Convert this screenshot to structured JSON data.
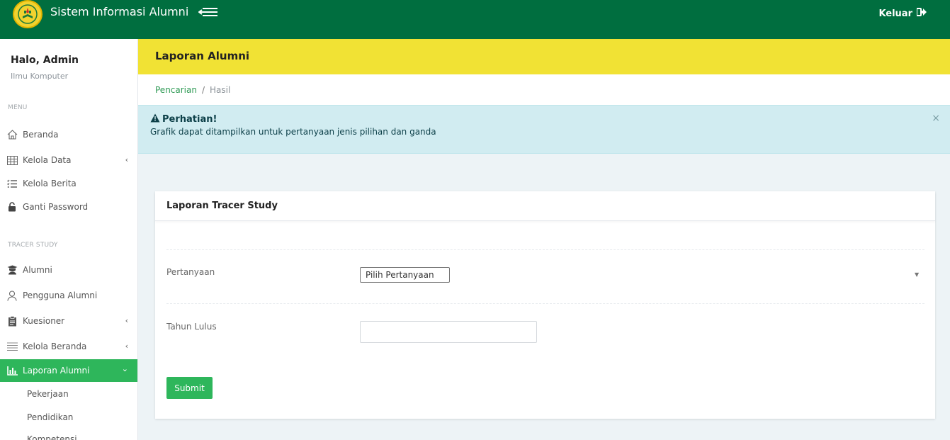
{
  "header": {
    "app_title": "Sistem Informasi Alumni",
    "logout_label": "Keluar"
  },
  "sidebar": {
    "greeting": "Halo, Admin",
    "subtitle": "Ilmu Komputer",
    "menu_label": "MENU",
    "tracer_label": "TRACER STUDY",
    "items": [
      {
        "label": "Beranda",
        "icon": "home-icon"
      },
      {
        "label": "Kelola Data",
        "icon": "table-icon"
      },
      {
        "label": "Kelola Berita",
        "icon": "checklist-icon"
      },
      {
        "label": "Ganti Password",
        "icon": "lock-icon"
      },
      {
        "label": "Alumni",
        "icon": "graduate-icon"
      },
      {
        "label": "Pengguna Alumni",
        "icon": "user-icon"
      },
      {
        "label": "Kuesioner",
        "icon": "clipboard-icon"
      },
      {
        "label": "Kelola Beranda",
        "icon": "list-icon"
      },
      {
        "label": "Laporan Alumni",
        "icon": "bar-chart-icon"
      }
    ],
    "sub_items": [
      {
        "label": "Pekerjaan"
      },
      {
        "label": "Pendidikan"
      },
      {
        "label": "Kompetensi"
      }
    ]
  },
  "page": {
    "title": "Laporan Alumni",
    "breadcrumb": {
      "link": "Pencarian",
      "separator": "/",
      "current": "Hasil"
    }
  },
  "alert": {
    "title": "Perhatian!",
    "text": "Grafik dapat ditampilkan untuk pertanyaan jenis pilihan dan ganda",
    "close": "×"
  },
  "card": {
    "title": "Laporan Tracer Study",
    "question_label": "Pertanyaan",
    "question_value": "Pilih Pertanyaan",
    "year_label": "Tahun Lulus",
    "year_value": "",
    "submit_label": "Submit"
  },
  "colors": {
    "topbar": "#006e3f",
    "header_yellow": "#f1e234",
    "accent_green": "#2eb65b",
    "alert_bg": "#d1ecf1"
  }
}
